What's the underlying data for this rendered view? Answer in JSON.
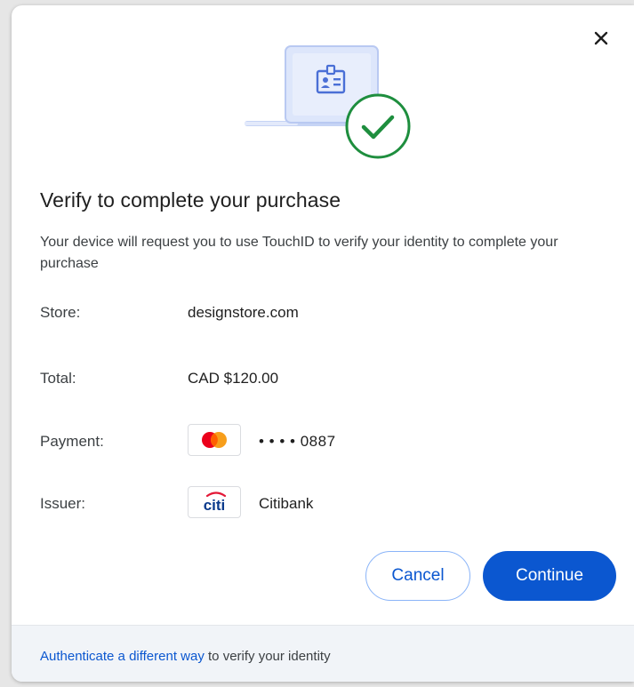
{
  "dialog": {
    "title": "Verify to complete your purchase",
    "subtitle": "Your device will request you to use TouchID to verify your identity to complete your purchase",
    "close_icon": "close-icon"
  },
  "details": {
    "store": {
      "label": "Store:",
      "value": "designstore.com"
    },
    "total": {
      "label": "Total:",
      "value": "CAD $120.00"
    },
    "payment": {
      "label": "Payment:",
      "value": "• • • • 0887",
      "logo": "mastercard-logo"
    },
    "issuer": {
      "label": "Issuer:",
      "value": "Citibank",
      "logo": "citi-logo",
      "logo_text": "citi"
    }
  },
  "actions": {
    "cancel_label": "Cancel",
    "continue_label": "Continue"
  },
  "footer": {
    "link_text": "Authenticate a different way",
    "rest_text": " to verify your identity"
  },
  "colors": {
    "primary": "#0b57d0",
    "success_green": "#1e8e3e",
    "footer_bg": "#f1f4f8"
  }
}
